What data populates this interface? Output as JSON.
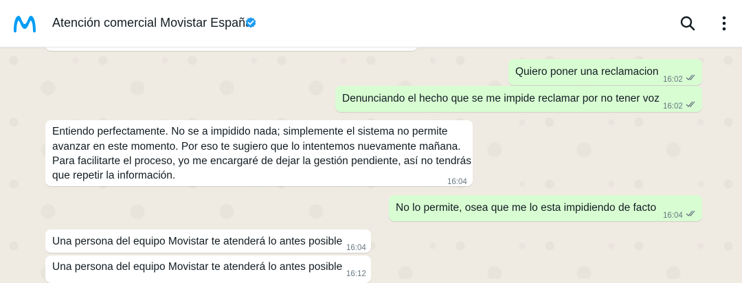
{
  "header": {
    "contact_name": "Atención comercial Movistar España",
    "verified": true,
    "logo": "movistar-m-logo",
    "actions": [
      "search-icon",
      "menu-icon"
    ]
  },
  "colors": {
    "outgoing_bubble": "#d9fdd3",
    "incoming_bubble": "#ffffff",
    "brand": "#019df4",
    "ticks": "#667781"
  },
  "messages": [
    {
      "direction": "outgoing",
      "text": "Quiero poner una reclamacion",
      "time": "16:02",
      "status": "double-check"
    },
    {
      "direction": "outgoing",
      "text": "Denunciando el hecho que se me impide reclamar por no tener voz",
      "time": "16:02",
      "status": "double-check"
    },
    {
      "direction": "incoming",
      "lines": [
        "Entiendo perfectamente. No se a impidido nada; simplemente el sistema no permite",
        "avanzar en este momento. Por eso te sugiero que lo intentemos nuevamente mañana.",
        "Para facilitarte el proceso, yo me encargaré de dejar la gestión pendiente, así no tendrás",
        "que repetir la información."
      ],
      "time": "16:04"
    },
    {
      "direction": "outgoing",
      "text": "No lo permite, osea que me lo esta impidiendo de facto",
      "time": "16:04",
      "status": "double-check"
    },
    {
      "direction": "incoming",
      "text": "Una persona del equipo Movistar te atenderá lo antes posible",
      "time": "16:04"
    },
    {
      "direction": "incoming",
      "text": "Una persona del equipo Movistar te atenderá lo antes posible",
      "time": "16:12"
    }
  ]
}
